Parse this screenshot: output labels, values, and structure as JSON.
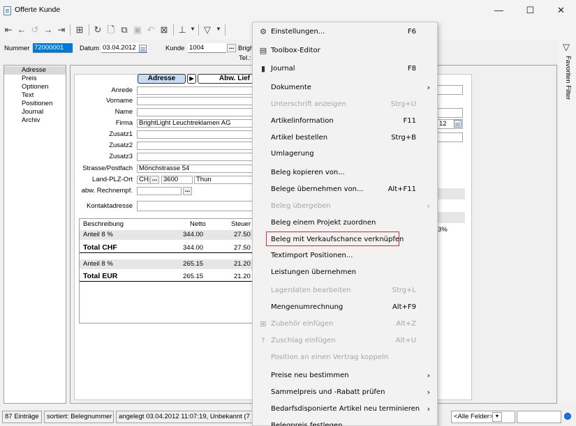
{
  "window": {
    "title": "Offerte Kunde",
    "min": "—",
    "max": "☐",
    "close": "✕"
  },
  "header": {
    "nummer_label": "Nummer",
    "nummer_value": "72000001",
    "datum_label": "Datum",
    "datum_value": "03.04.2012",
    "kunde_label": "Kunde",
    "kunde_value": "1004",
    "kunde_name": "Brigh",
    "tel_label": "Tel.:"
  },
  "sidenav": {
    "items": [
      "Adresse",
      "Preis",
      "Optionen",
      "Text",
      "Positionen",
      "Journal",
      "Archiv"
    ],
    "selected": "Adresse"
  },
  "filter": {
    "label": "Favoriten Filter"
  },
  "tabs": {
    "adresse": "Adresse",
    "abw": "Abw. Lief"
  },
  "address": {
    "anrede_label": "Anrede",
    "vorname_label": "Vorname",
    "name_label": "Name",
    "firma_label": "Firma",
    "firma_value": "BrightLight Leuchtreklamen AG",
    "zusatz1_label": "Zusatz1",
    "zusatz2_label": "Zusatz2",
    "zusatz3_label": "Zusatz3",
    "strasse_label": "Strasse/Postfach",
    "strasse_value": "Mönchstrasse 54",
    "plz_label": "Land-PLZ-Ort",
    "land_value": "CH",
    "plz_value": "3600",
    "ort_value": "Thun",
    "abw_label": "abw. Rechnempf.",
    "kontakt_label": "Kontaktadresse"
  },
  "table": {
    "headers": [
      "Beschreibung",
      "Netto",
      "Steuer"
    ],
    "rows": [
      {
        "beschreibung": "Anteil 8 %",
        "netto": "344.00",
        "steuer": "27.50"
      },
      {
        "beschreibung": "Total CHF",
        "netto": "344.00",
        "steuer": "27.50"
      },
      {
        "beschreibung": "Anteil 8 %",
        "netto": "265.15",
        "steuer": "21.20"
      },
      {
        "beschreibung": "Total EUR",
        "netto": "265.15",
        "steuer": "21.20"
      }
    ]
  },
  "right_remnants": {
    "date_fragment": "12",
    "pct_fragment": "3%"
  },
  "statusbar": {
    "count": "87 Einträge",
    "sort": "sortiert: Belegnummer",
    "created": "angelegt 03.04.2012 11:07:19, Unbekannt (7",
    "filter_select": "<Alle Felder>"
  },
  "menu": {
    "items": [
      {
        "label": "Einstellungen...",
        "key": "F6",
        "icon": "gear-icon",
        "glyph": "⚙",
        "disabled": false,
        "sub": false
      },
      {
        "label": "Toolbox-Editor",
        "key": "",
        "icon": "toolbox-icon",
        "glyph": "▤",
        "disabled": false,
        "sub": false
      },
      {
        "label": "Journal",
        "key": "F8",
        "icon": "journal-icon",
        "glyph": "▮",
        "disabled": false,
        "sub": false
      },
      {
        "label": "Dokumente",
        "key": "",
        "icon": "",
        "glyph": "",
        "disabled": false,
        "sub": true
      },
      {
        "label": "Unterschrift anzeigen",
        "key": "Strg+U",
        "icon": "",
        "glyph": "",
        "disabled": true,
        "sub": false
      },
      {
        "label": "Artikelinformation",
        "key": "F11",
        "icon": "",
        "glyph": "",
        "disabled": false,
        "sub": false
      },
      {
        "label": "Artikel bestellen",
        "key": "Strg+B",
        "icon": "",
        "glyph": "",
        "disabled": false,
        "sub": false
      },
      {
        "label": "Umlagerung",
        "key": "",
        "icon": "",
        "glyph": "",
        "disabled": false,
        "sub": false
      },
      {
        "label": "Beleg kopieren von...",
        "key": "",
        "icon": "",
        "glyph": "",
        "disabled": false,
        "sub": false
      },
      {
        "label": "Belege übernehmen von...",
        "key": "Alt+F11",
        "icon": "",
        "glyph": "",
        "disabled": false,
        "sub": false
      },
      {
        "label": "Beleg übergeben",
        "key": "",
        "icon": "",
        "glyph": "",
        "disabled": true,
        "sub": true
      },
      {
        "label": "Beleg einem Projekt zuordnen",
        "key": "",
        "icon": "",
        "glyph": "",
        "disabled": false,
        "sub": false
      },
      {
        "label": "Beleg mit Verkaufschance verknüpfen",
        "key": "",
        "icon": "",
        "glyph": "",
        "disabled": false,
        "sub": false
      },
      {
        "label": "Textimport Positionen...",
        "key": "",
        "icon": "",
        "glyph": "",
        "disabled": false,
        "sub": false
      },
      {
        "label": "Leistungen übernehmen",
        "key": "",
        "icon": "",
        "glyph": "",
        "disabled": false,
        "sub": false
      },
      {
        "label": "Lagerdaten bearbeiten",
        "key": "Strg+L",
        "icon": "",
        "glyph": "",
        "disabled": true,
        "sub": false
      },
      {
        "label": "Mengenumrechnung",
        "key": "Alt+F9",
        "icon": "",
        "glyph": "",
        "disabled": false,
        "sub": false
      },
      {
        "label": "Zubehör einfügen",
        "key": "Alt+Z",
        "icon": "add-accessory-icon",
        "glyph": "⊞",
        "disabled": true,
        "sub": false
      },
      {
        "label": "Zuschlag einfügen",
        "key": "Alt+U",
        "icon": "surcharge-icon",
        "glyph": "⤒",
        "disabled": true,
        "sub": false
      },
      {
        "label": "Position an einen Vertrag koppeln",
        "key": "",
        "icon": "",
        "glyph": "",
        "disabled": true,
        "sub": false
      },
      {
        "label": "Preise neu bestimmen",
        "key": "",
        "icon": "",
        "glyph": "",
        "disabled": false,
        "sub": true
      },
      {
        "label": "Sammelpreis und -Rabatt prüfen",
        "key": "",
        "icon": "",
        "glyph": "",
        "disabled": false,
        "sub": true
      },
      {
        "label": "Bedarfsdisponierte Artikel neu terminieren",
        "key": "",
        "icon": "",
        "glyph": "",
        "disabled": false,
        "sub": true
      },
      {
        "label": "Belegpreis festlegen",
        "key": "",
        "icon": "",
        "glyph": "",
        "disabled": false,
        "sub": false
      }
    ],
    "highlighted": "Beleg mit Verkaufschance verknüpfen"
  },
  "colors": {
    "selection_blue": "#0078d7",
    "tab_active": "#c6dcf5",
    "highlight_red": "#d23232"
  }
}
